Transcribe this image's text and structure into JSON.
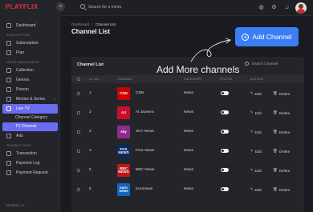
{
  "app": {
    "logo": "PLAYFLIX",
    "version": "VERSION 1.0"
  },
  "sidebar": {
    "collapse_icon": "«",
    "items": [
      {
        "type": "item",
        "label": "Dashboard",
        "icon": "dashboard-icon"
      },
      {
        "type": "section",
        "label": "Subscription"
      },
      {
        "type": "item",
        "label": "Subscription",
        "icon": "subscription-icon"
      },
      {
        "type": "item",
        "label": "Plan",
        "icon": "plan-icon"
      },
      {
        "type": "section",
        "label": "Media Management"
      },
      {
        "type": "item",
        "label": "Collection",
        "icon": "collection-icon"
      },
      {
        "type": "item",
        "label": "Genres",
        "icon": "genres-icon"
      },
      {
        "type": "item",
        "label": "Person",
        "icon": "person-icon"
      },
      {
        "type": "item",
        "label": "Movies & Series",
        "icon": "movies-icon",
        "chevron": "›"
      },
      {
        "type": "item",
        "label": "Live TV",
        "icon": "live-tv-icon",
        "chevron": "⌄",
        "active": true
      },
      {
        "type": "sub",
        "label": "Channel Category"
      },
      {
        "type": "sub",
        "label": "TV Channel",
        "active": true
      },
      {
        "type": "item",
        "label": "Ads",
        "icon": "ads-icon"
      },
      {
        "type": "section",
        "label": "Transactions"
      },
      {
        "type": "item",
        "label": "Transaction",
        "icon": "transaction-icon"
      },
      {
        "type": "item",
        "label": "Payment Log",
        "icon": "payment-log-icon"
      },
      {
        "type": "item",
        "label": "Payment Request",
        "icon": "payment-request-icon"
      }
    ]
  },
  "topbar": {
    "search_placeholder": "Search for a menu"
  },
  "header": {
    "breadcrumb": [
      "Dashboard",
      "Channel List"
    ],
    "title": "Channel List",
    "add_button": "Add Channel",
    "plus": "+"
  },
  "annotation": "Add More channels",
  "table": {
    "title": "Channel List",
    "search_placeholder": "Search Channel",
    "columns": [
      "SL NO.",
      "Channel",
      "Category",
      "Status",
      "Action"
    ],
    "edit_label": "Edit",
    "delete_label": "Delete",
    "rows": [
      {
        "sl": "1",
        "name": "CNN",
        "category": "News",
        "logo_text": "CNN",
        "logo_bg": "#cc0000",
        "status": false
      },
      {
        "sl": "2",
        "name": "Al Jazeera",
        "category": "News",
        "logo_text": "AJ",
        "logo_bg": "#c8102e",
        "status": false
      },
      {
        "sl": "3",
        "name": "SKY News",
        "category": "News",
        "logo_text": "sky",
        "logo_bg": "#8e2a8e",
        "status": false
      },
      {
        "sl": "4",
        "name": "FOX News",
        "category": "News",
        "logo_text": "FOX NEWS",
        "logo_bg": "#0b2a5e",
        "status": false
      },
      {
        "sl": "5",
        "name": "BBC News",
        "category": "News",
        "logo_text": "BBC NEWS",
        "logo_bg": "#bb1919",
        "status": false
      },
      {
        "sl": "6",
        "name": "Euronews",
        "category": "News",
        "logo_text": "euro news",
        "logo_bg": "#1565c0",
        "status": false
      }
    ]
  },
  "colors": {
    "accent": "#6b6cf0",
    "primary_button": "#3b7ef6",
    "brand": "#e0303d"
  }
}
